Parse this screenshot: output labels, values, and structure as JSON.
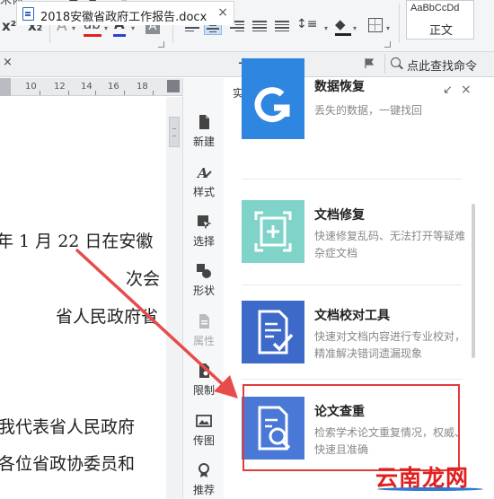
{
  "toolbar": {
    "font_name": "宋体",
    "superscript": "x²",
    "subscript": "x₂",
    "outline_a": "A",
    "highlight": "ab",
    "font_color": "A",
    "char_shading": "A",
    "style_preview": "AaBbCcDd",
    "style_name": "正文"
  },
  "tabbar": {
    "close_left": "×",
    "doc_title": "2018安徽省政府工作报告.docx",
    "doc_close": "×",
    "new_tab": "+",
    "find_text": "点此查找命令"
  },
  "ruler": {
    "marks": [
      "10",
      "12",
      "14",
      "16",
      "18"
    ]
  },
  "document": {
    "lines": [
      "年 1 月 22 日在安徽",
      "次会",
      "省人民政府省",
      "我代表省人民政府",
      "各位省政协委员和"
    ]
  },
  "strip": {
    "items": [
      {
        "label": "新建",
        "icon": "new-doc-icon"
      },
      {
        "label": "样式",
        "icon": "style-icon"
      },
      {
        "label": "选择",
        "icon": "select-cursor-icon"
      },
      {
        "label": "形状",
        "icon": "shapes-icon"
      },
      {
        "label": "属性",
        "icon": "properties-icon"
      },
      {
        "label": "限制",
        "icon": "restrict-icon"
      },
      {
        "label": "传图",
        "icon": "upload-image-icon"
      },
      {
        "label": "推荐",
        "icon": "recommend-icon"
      }
    ]
  },
  "panel": {
    "title": "实用工具",
    "dropdown": "▼",
    "dock": "↙",
    "close": "×",
    "tools": [
      {
        "name": "数据恢复",
        "desc": "丢失的数据，一键找回",
        "color": "#2f86e0"
      },
      {
        "name": "文档修复",
        "desc": "快速修复乱码、无法打开等疑难杂症文档",
        "color": "#7fd3c8"
      },
      {
        "name": "文档校对工具",
        "desc": "快速对文档内容进行专业校对，精准解决错词遗漏现象",
        "color": "#3d69c9"
      },
      {
        "name": "论文查重",
        "desc": "检索学术论文重复情况，权威、快速且准确",
        "color": "#4a78d6"
      }
    ]
  },
  "watermark": {
    "text": "云南龙网"
  },
  "colors": {
    "highlight_border": "#e23b3b",
    "arrow": "#e84b4b",
    "accent_blue": "#2f64b8"
  }
}
